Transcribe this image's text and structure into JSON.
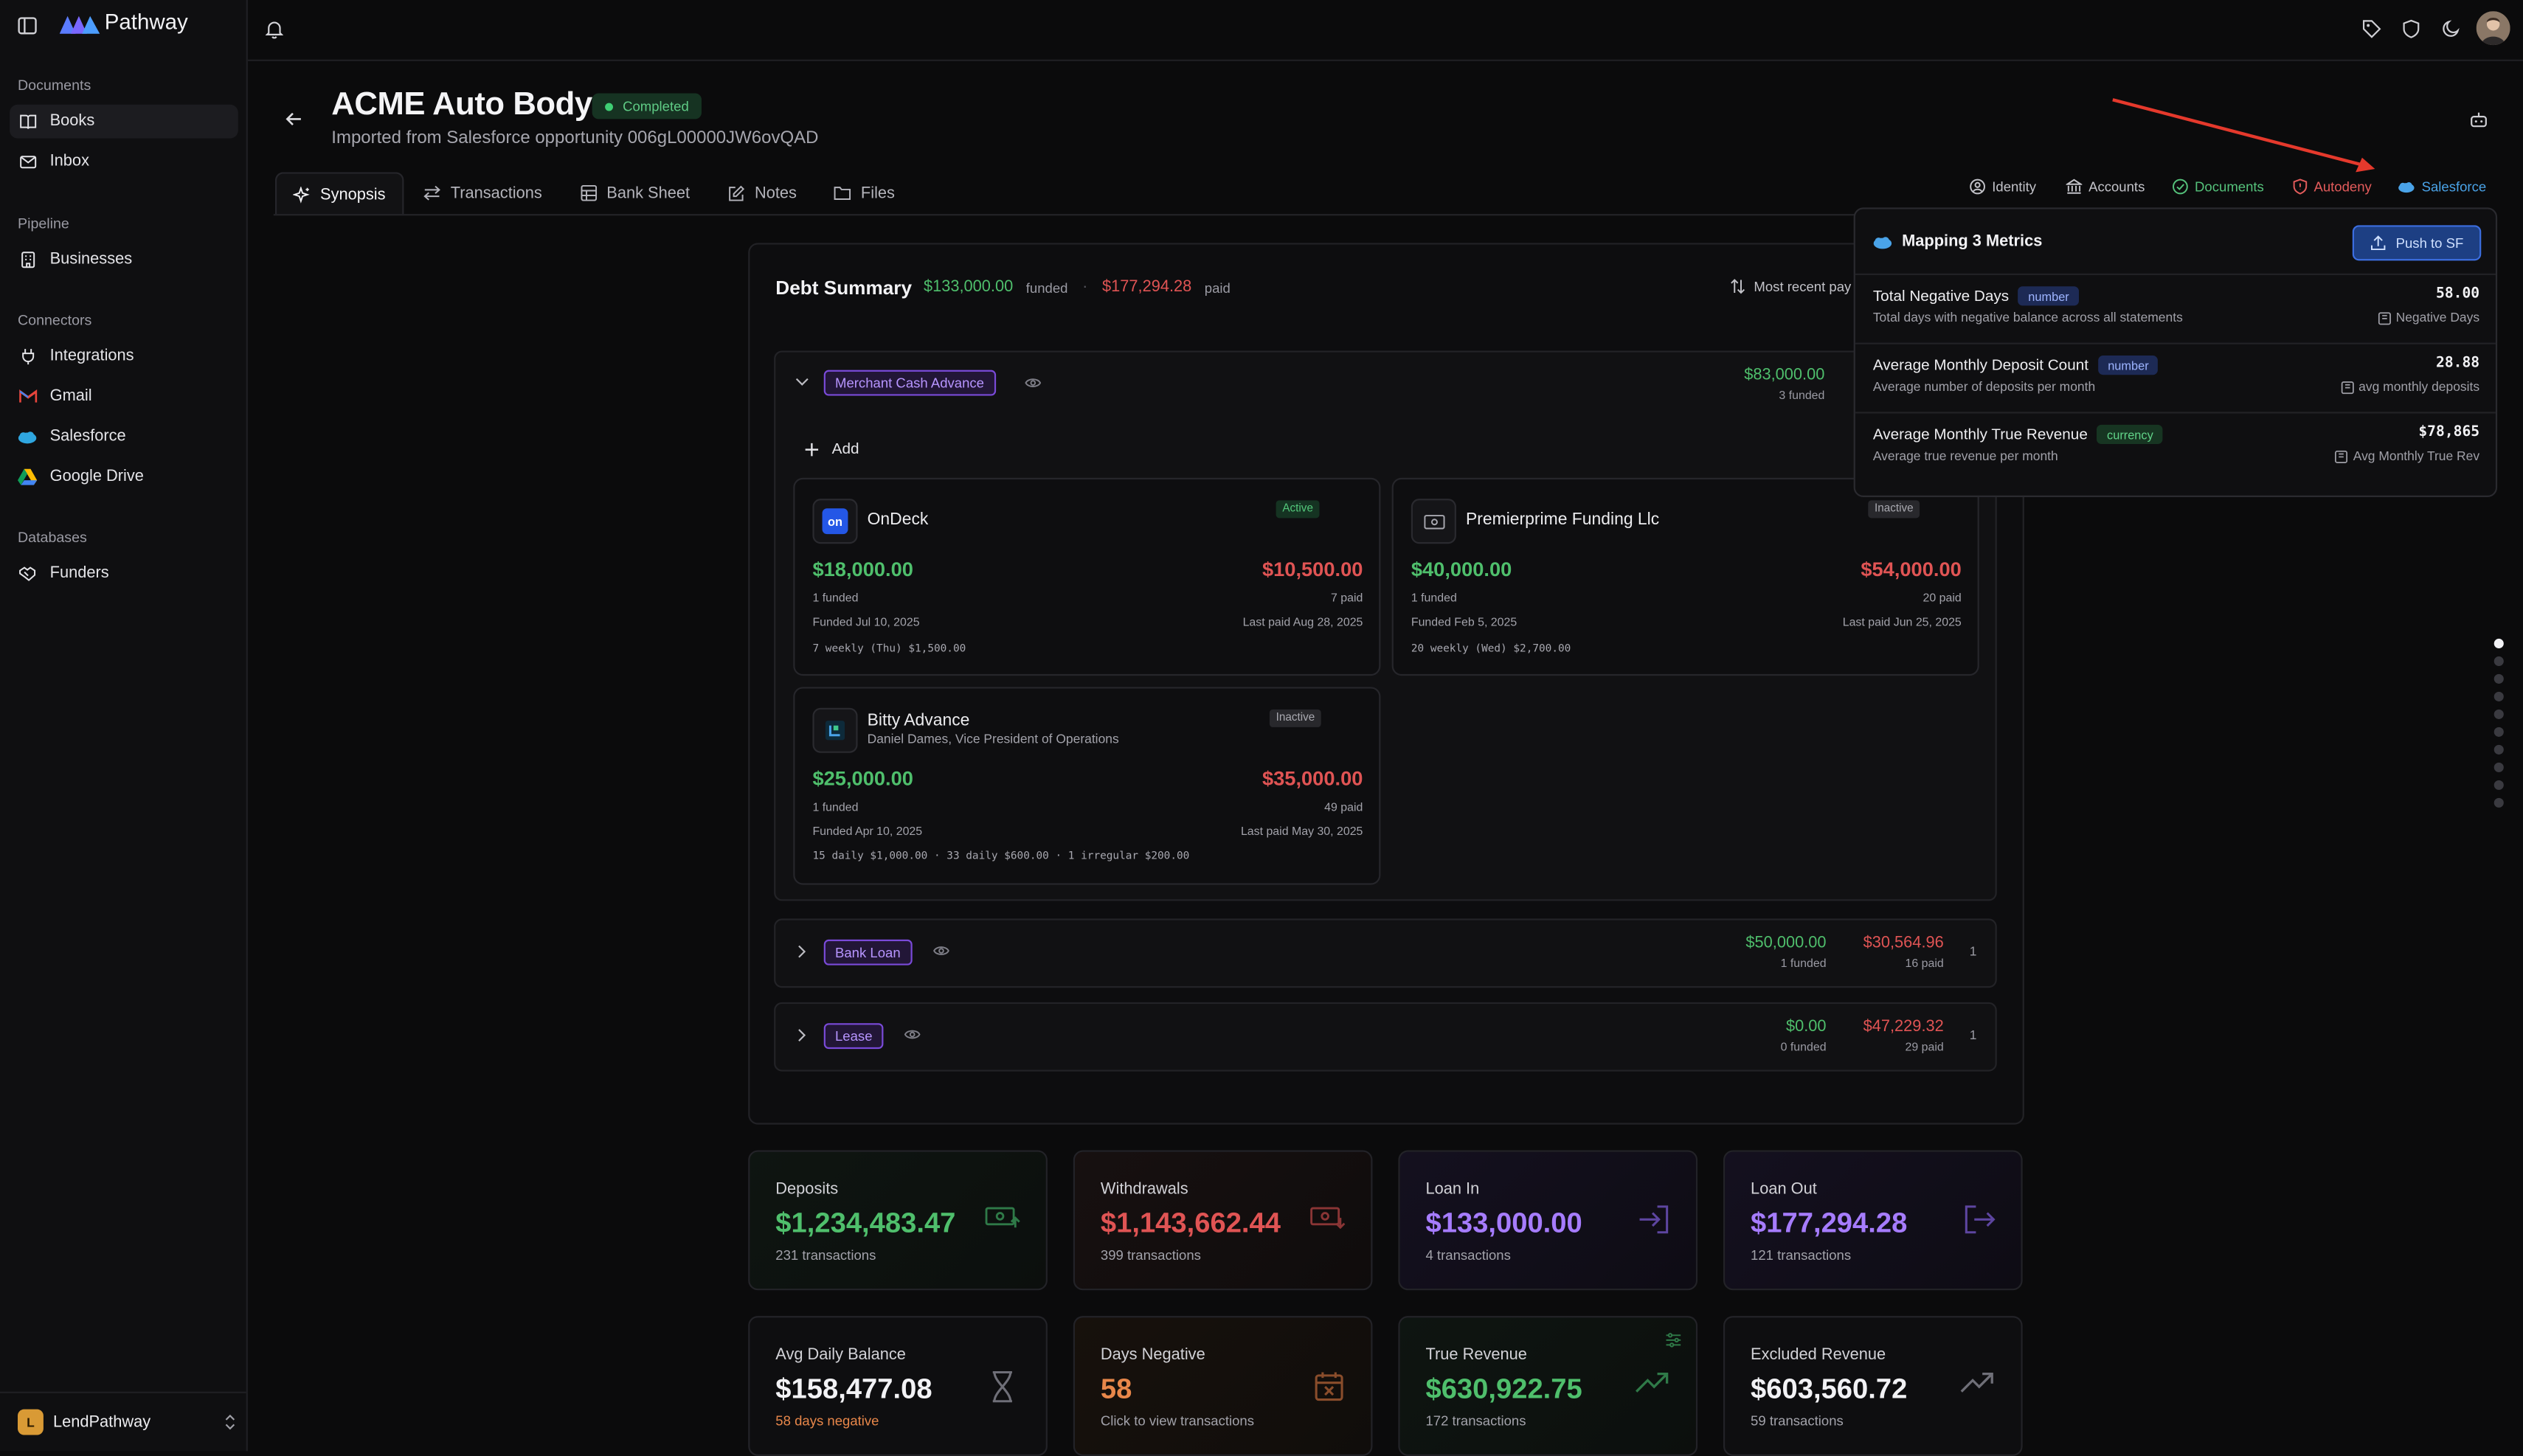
{
  "app": {
    "brand": "Pathway",
    "org": "LendPathway",
    "org_initial": "L"
  },
  "sidebar": {
    "sections": [
      "Documents",
      "Pipeline",
      "Connectors",
      "Databases"
    ],
    "items": [
      {
        "label": "Books"
      },
      {
        "label": "Inbox"
      },
      {
        "label": "Businesses"
      },
      {
        "label": "Integrations"
      },
      {
        "label": "Gmail"
      },
      {
        "label": "Salesforce"
      },
      {
        "label": "Google Drive"
      },
      {
        "label": "Funders"
      }
    ]
  },
  "header": {
    "title": "ACME Auto Body",
    "status": "Completed",
    "subtitle": "Imported from Salesforce opportunity 006gL00000JW6ovQAD"
  },
  "tabs": [
    "Synopsis",
    "Transactions",
    "Bank Sheet",
    "Notes",
    "Files"
  ],
  "right_tabs": [
    "Identity",
    "Accounts",
    "Documents",
    "Autodeny",
    "Salesforce"
  ],
  "colors": {
    "accent_green": "#4fbf6c",
    "accent_red": "#e05454",
    "accent_purple": "#9a6cff",
    "salesforce_blue": "#4aa3e8"
  },
  "debt_summary": {
    "title": "Debt Summary",
    "funded": "$133,000.00",
    "funded_label": "funded",
    "paid": "$177,294.28",
    "paid_label": "paid",
    "sort_label": "Most recent pay",
    "add_label": "Add",
    "groups": [
      {
        "name": "Merchant Cash Advance",
        "funded": "$83,000.00",
        "funded_sub": "3 funded"
      },
      {
        "name": "Bank Loan",
        "funded": "$50,000.00",
        "funded_sub": "1 funded",
        "paid": "$30,564.96",
        "paid_sub": "16 paid",
        "count": "1"
      },
      {
        "name": "Lease",
        "funded": "$0.00",
        "funded_sub": "0 funded",
        "paid": "$47,229.32",
        "paid_sub": "29 paid",
        "count": "1"
      }
    ],
    "cards": [
      {
        "name": "OnDeck",
        "logo": "on",
        "status": "Active",
        "funded": "$18,000.00",
        "funded_sub": "1 funded",
        "paid": "$10,500.00",
        "paid_sub": "7 paid",
        "funded_date": "Funded Jul 10, 2025",
        "last_paid": "Last paid Aug 28, 2025",
        "schedule": "7 weekly (Thu) $1,500.00"
      },
      {
        "name": "Premierprime Funding Llc",
        "status": "Inactive",
        "funded": "$40,000.00",
        "funded_sub": "1 funded",
        "paid": "$54,000.00",
        "paid_sub": "20 paid",
        "funded_date": "Funded Feb 5, 2025",
        "last_paid": "Last paid Jun 25, 2025",
        "schedule": "20 weekly (Wed) $2,700.00"
      },
      {
        "name": "Bitty Advance",
        "contact": "Daniel Dames, Vice President of Operations",
        "status": "Inactive",
        "funded": "$25,000.00",
        "funded_sub": "1 funded",
        "paid": "$35,000.00",
        "paid_sub": "49 paid",
        "funded_date": "Funded Apr 10, 2025",
        "last_paid": "Last paid May 30, 2025",
        "schedule": "15 daily $1,000.00 · 33 daily $600.00 · 1 irregular $200.00"
      }
    ]
  },
  "stats": [
    {
      "label": "Deposits",
      "value": "$1,234,483.47",
      "sub": "231 transactions",
      "color": "#4fbf6c"
    },
    {
      "label": "Withdrawals",
      "value": "$1,143,662.44",
      "sub": "399 transactions",
      "color": "#e05454"
    },
    {
      "label": "Loan In",
      "value": "$133,000.00",
      "sub": "4 transactions",
      "color": "#a67cff"
    },
    {
      "label": "Loan Out",
      "value": "$177,294.28",
      "sub": "121 transactions",
      "color": "#a67cff"
    },
    {
      "label": "Avg Daily Balance",
      "value": "$158,477.08",
      "sub": "58 days negative",
      "color": "#f2f2f5"
    },
    {
      "label": "Days Negative",
      "value": "58",
      "sub": "Click to view transactions",
      "color": "#e8874a"
    },
    {
      "label": "True Revenue",
      "value": "$630,922.75",
      "sub": "172 transactions",
      "color": "#4fbf6c"
    },
    {
      "label": "Excluded Revenue",
      "value": "$603,560.72",
      "sub": "59 transactions",
      "color": "#f2f2f5"
    }
  ],
  "mapping": {
    "title": "Mapping 3 Metrics",
    "push_label": "Push to SF",
    "metrics": [
      {
        "name": "Total Negative Days",
        "type": "number",
        "desc": "Total days with negative balance across all statements",
        "value": "58.00",
        "field": "Negative Days"
      },
      {
        "name": "Average Monthly Deposit Count",
        "type": "number",
        "desc": "Average number of deposits per month",
        "value": "28.88",
        "field": "avg monthly deposits"
      },
      {
        "name": "Average Monthly True Revenue",
        "type": "currency",
        "desc": "Average true revenue per month",
        "value": "$78,865",
        "field": "Avg Monthly True Rev"
      }
    ]
  },
  "pager": {
    "dots": 10,
    "active": 1
  }
}
